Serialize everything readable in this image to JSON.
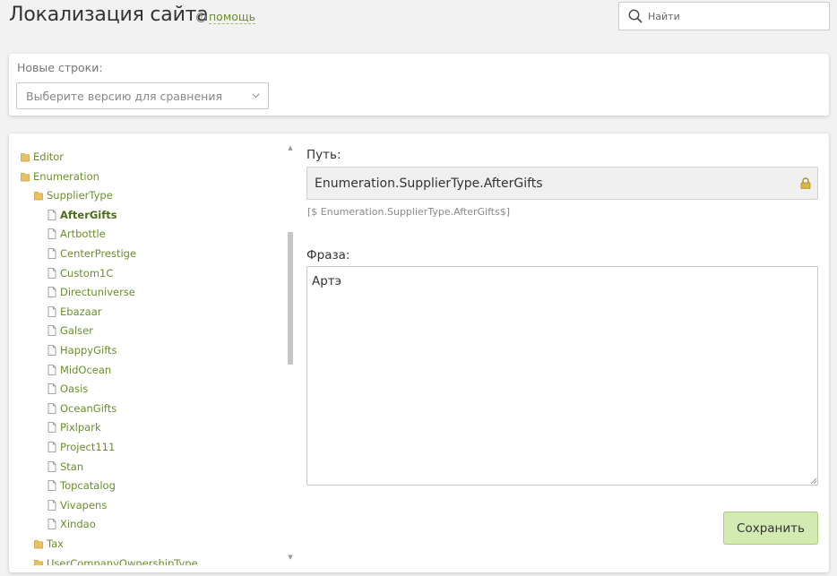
{
  "header": {
    "title": "Локализация сайта",
    "help_label": "помощь",
    "help_icon": "question-circle-icon",
    "search_placeholder": "Найти"
  },
  "compare": {
    "label": "Новые строки:",
    "select_placeholder": "Выберите версию для сравнения"
  },
  "tree": {
    "items": [
      {
        "label": "Editor",
        "type": "folder",
        "level": 0
      },
      {
        "label": "Enumeration",
        "type": "folder",
        "level": 0
      },
      {
        "label": "SupplierType",
        "type": "folder",
        "level": 1
      },
      {
        "label": "AfterGifts",
        "type": "file",
        "level": 2,
        "selected": true
      },
      {
        "label": "Artbottle",
        "type": "file",
        "level": 2
      },
      {
        "label": "CenterPrestige",
        "type": "file",
        "level": 2
      },
      {
        "label": "Custom1C",
        "type": "file",
        "level": 2
      },
      {
        "label": "Directuniverse",
        "type": "file",
        "level": 2
      },
      {
        "label": "Ebazaar",
        "type": "file",
        "level": 2
      },
      {
        "label": "Galser",
        "type": "file",
        "level": 2
      },
      {
        "label": "HappyGifts",
        "type": "file",
        "level": 2
      },
      {
        "label": "MidOcean",
        "type": "file",
        "level": 2
      },
      {
        "label": "Oasis",
        "type": "file",
        "level": 2
      },
      {
        "label": "OceanGifts",
        "type": "file",
        "level": 2
      },
      {
        "label": "Pixlpark",
        "type": "file",
        "level": 2
      },
      {
        "label": "Project111",
        "type": "file",
        "level": 2
      },
      {
        "label": "Stan",
        "type": "file",
        "level": 2
      },
      {
        "label": "Topcatalog",
        "type": "file",
        "level": 2
      },
      {
        "label": "Vivapens",
        "type": "file",
        "level": 2
      },
      {
        "label": "Xindao",
        "type": "file",
        "level": 2
      },
      {
        "label": "Tax",
        "type": "folder",
        "level": 1
      },
      {
        "label": "UserCompanyOwnershipType",
        "type": "folder",
        "level": 1
      }
    ]
  },
  "detail": {
    "path_label": "Путь:",
    "path_value": "Enumeration.SupplierType.AfterGifts",
    "path_code": "[$ Enumeration.SupplierType.AfterGifts$]",
    "phrase_label": "Фраза:",
    "phrase_value": "Артэ",
    "save_label": "Сохранить"
  },
  "colors": {
    "accent": "#6a8f2b",
    "folder": "#e8c167",
    "save_bg": "#d3eab3"
  }
}
